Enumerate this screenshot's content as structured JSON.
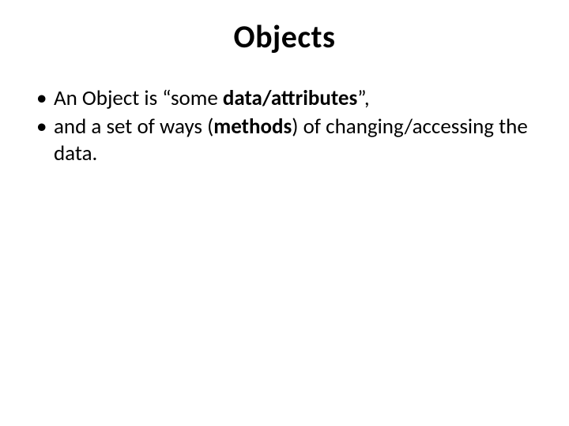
{
  "slide": {
    "title": "Objects",
    "bullets": [
      {
        "pre": "An Object is “some ",
        "bold": "data/attributes",
        "post": "”,"
      },
      {
        "pre": "and a set of ways (",
        "bold": "methods",
        "post": ") of changing/accessing the data."
      }
    ]
  }
}
